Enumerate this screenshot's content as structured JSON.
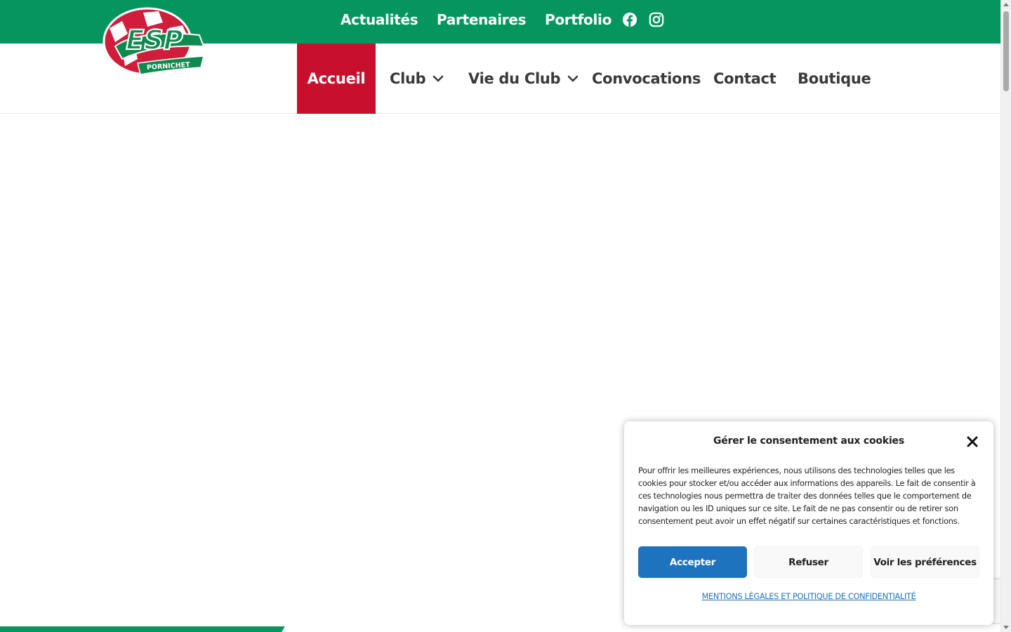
{
  "topbar": {
    "links": [
      "Actualités",
      "Partenaires",
      "Portfolio"
    ],
    "social": [
      "facebook-icon",
      "instagram-icon"
    ],
    "color": "#05965f"
  },
  "logo": {
    "text_main": "ESP",
    "text_sub": "PORNICHET"
  },
  "nav": {
    "items": [
      "Accueil",
      "Club",
      "Vie du Club",
      "Convocations",
      "Contact",
      "Boutique"
    ],
    "active_color": "#c8102e"
  },
  "cookie": {
    "title": "Gérer le consentement aux cookies",
    "text": "Pour offrir les meilleures expériences, nous utilisons des technologies telles que les cookies pour stocker et/ou accéder aux informations des appareils. Le fait de consentir à ces technologies nous permettra de traiter des données telles que le comportement de navigation ou les ID uniques sur ce site. Le fait de ne pas consentir ou de retirer son consentement peut avoir un effet négatif sur certaines caractéristiques et fonctions.",
    "accept": "Accepter",
    "refuse": "Refuser",
    "prefs": "Voir les préférences",
    "legal_link": "MENTIONS LÉGALES ET POLITIQUE DE CONFIDENTIALITÉ",
    "accent": "#1e73be"
  }
}
